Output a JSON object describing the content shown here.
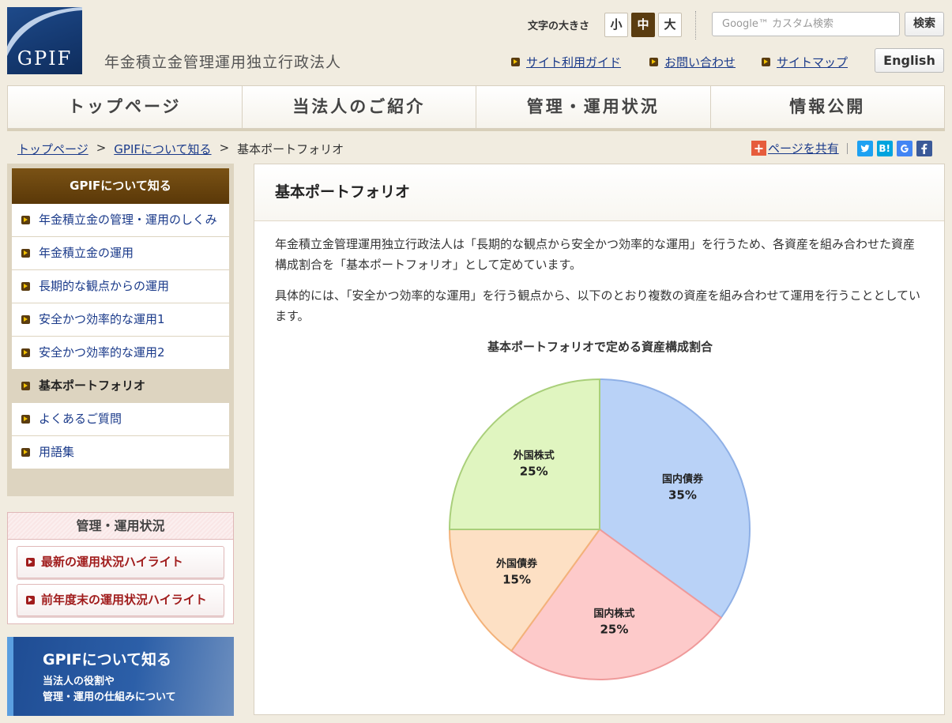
{
  "header": {
    "logo_text": "GPIF",
    "org_name": "年金積立金管理運用独立行政法人",
    "font_size_label": "文字の大きさ",
    "font_sizes": [
      "小",
      "中",
      "大"
    ],
    "search_placeholder": "Google™ カスタム検索",
    "search_button": "検索",
    "util_links": [
      "サイト利用ガイド",
      "お問い合わせ",
      "サイトマップ"
    ],
    "english_button": "English"
  },
  "global_nav": [
    "トップページ",
    "当法人のご紹介",
    "管理・運用状況",
    "情報公開"
  ],
  "breadcrumb": {
    "items": [
      "トップページ",
      "GPIFについて知る"
    ],
    "current": "基本ポートフォリオ",
    "separator": ">"
  },
  "share": {
    "label": "ページを共有",
    "icons": [
      "twitter-icon",
      "hatena-bookmark-icon",
      "google-icon",
      "facebook-icon"
    ],
    "hatena_text": "B!"
  },
  "sidebar": {
    "title": "GPIFについて知る",
    "items": [
      "年金積立金の管理・運用のしくみ",
      "年金積立金の運用",
      "長期的な観点からの運用",
      "安全かつ効率的な運用1",
      "安全かつ効率的な運用2",
      "基本ポートフォリオ",
      "よくあるご質問",
      "用語集"
    ],
    "current_index": 5
  },
  "status_box": {
    "title": "管理・運用状況",
    "buttons": [
      "最新の運用状況ハイライト",
      "前年度末の運用状況ハイライト"
    ]
  },
  "banner": {
    "title": "GPIFについて知る",
    "sub1": "当法人の役割や",
    "sub2": "管理・運用の仕組みについて"
  },
  "main": {
    "title": "基本ポートフォリオ",
    "para1": "年金積立金管理運用独立行政法人は「長期的な観点から安全かつ効率的な運用」を行うため、各資産を組み合わせた資産構成割合を「基本ポートフォリオ」として定めています。",
    "para2": "具体的には、「安全かつ効率的な運用」を行う観点から、以下のとおり複数の資産を組み合わせて運用を行うこととしています。"
  },
  "chart_data": {
    "type": "pie",
    "title": "基本ポートフォリオで定める資産構成割合",
    "slices": [
      {
        "label": "国内債券",
        "value": 35,
        "display": "35%",
        "color": "#b9d2f7"
      },
      {
        "label": "国内株式",
        "value": 25,
        "display": "25%",
        "color": "#fdcaca"
      },
      {
        "label": "外国債券",
        "value": 15,
        "display": "15%",
        "color": "#fde0c4"
      },
      {
        "label": "外国株式",
        "value": 25,
        "display": "25%",
        "color": "#e0f5c0"
      }
    ],
    "start": "12 o'clock",
    "direction": "clockwise"
  },
  "colors": {
    "brand_brown": "#5a3808",
    "link_blue": "#1a3a8a",
    "accent_red": "#a01c1c"
  }
}
